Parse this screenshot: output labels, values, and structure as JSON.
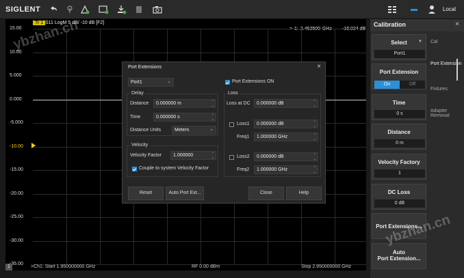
{
  "brand": "SIGLENT",
  "topbar": {
    "local_label": "Local"
  },
  "trace": {
    "tag": "Tr 1",
    "info": "S11 LogM 5 dB/ -10 dB [F2]"
  },
  "marker": {
    "readout": "> 1:  2.462500 GHz",
    "value": "-16.024 dB"
  },
  "y_axis_labels": [
    "15.00",
    "10.00",
    "5.000",
    "0.000",
    "-5.000",
    "-10.00",
    "-15.00",
    "-20.00",
    "-25.00",
    "-30.00",
    "-35.00"
  ],
  "ref_level_label": "-10.00",
  "bottom": {
    "channel": "1",
    "start": ">Ch1: Start 1.950000000 GHz",
    "rf": "RF 0.00 dBm",
    "stop": "Stop 2.950000000 GHz"
  },
  "watermark": "ybzhan.cn",
  "calibration": {
    "title": "Calibration",
    "select_label": "Select",
    "select_value": "Port1",
    "port_extension_label": "Port Extension",
    "on_label": "On",
    "off_label": "Off",
    "time_label": "Time",
    "time_value": "0 s",
    "distance_label": "Distance",
    "distance_value": "0 m",
    "velocity_label": "Velocity Factory",
    "velocity_value": "1",
    "dc_loss_label": "DC Loss",
    "dc_loss_value": "0 dB",
    "port_ext_dialog_label": "Port Extensions...",
    "auto_label": "Auto",
    "auto_label2": "Port Extension...",
    "tabs": [
      "Cal",
      "Port Extension",
      "Fixtures",
      "Adapter Removal"
    ]
  },
  "dialog": {
    "title": "Port Extensions",
    "port_select": "Port1",
    "port_ext_on": "Port Extensions ON",
    "delay_group": "Delay",
    "distance_label": "Distance",
    "distance_value": "0.000000 m",
    "time_label": "Time",
    "time_value": "0.000000 s",
    "distance_units_label": "Distance Units",
    "distance_units_value": "Meters",
    "velocity_group": "Velocity",
    "velocity_factor_label": "Velocity Factor",
    "velocity_factor_value": "1.000000",
    "couple_label": "Couple to system Velocity Factor",
    "loss_group": "Loss",
    "loss_dc_label": "Loss at DC",
    "loss_dc_value": "0.000000 dB",
    "loss1_label": "Loss1",
    "loss1_value": "0.000000 dB",
    "freq1_label": "Freq1",
    "freq1_value": "1.000000 GHz",
    "loss2_label": "Loss2",
    "loss2_value": "0.000000 dB",
    "freq2_label": "Freq2",
    "freq2_value": "1.000000 GHz",
    "reset_label": "Reset",
    "auto_label": "Auto Port Ext...",
    "close_label": "Close",
    "help_label": "Help"
  }
}
